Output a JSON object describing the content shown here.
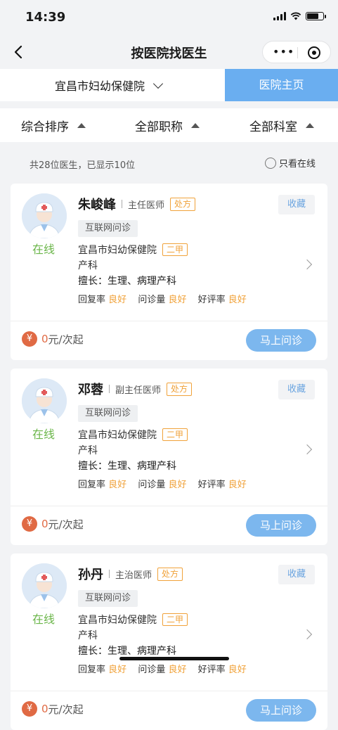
{
  "status": {
    "time": "14:39"
  },
  "nav": {
    "title": "按医院找医生"
  },
  "hospital_bar": {
    "name": "宜昌市妇幼保健院",
    "home_button": "医院主页"
  },
  "filters": [
    {
      "label": "综合排序"
    },
    {
      "label": "全部职称"
    },
    {
      "label": "全部科室"
    }
  ],
  "summary": {
    "count_text": "共28位医生，已显示10位",
    "online_only": "只看在线"
  },
  "doctors": [
    {
      "name": "朱峻峰",
      "title": "主任医师",
      "rx_tag": "处方",
      "favorite": "收藏",
      "status": "在线",
      "service": "互联网问诊",
      "hospital": "宜昌市妇幼保健院",
      "level": "二甲",
      "dept": "产科",
      "skill": "擅长：生理、病理产科",
      "reply_label": "回复率",
      "reply_value": "良好",
      "volume_label": "问诊量",
      "volume_value": "良好",
      "rating_label": "好评率",
      "rating_value": "良好",
      "price_symbol": "¥",
      "price_num": "0",
      "price_unit": "元/次起",
      "consult": "马上问诊"
    },
    {
      "name": "邓蓉",
      "title": "副主任医师",
      "rx_tag": "处方",
      "favorite": "收藏",
      "status": "在线",
      "service": "互联网问诊",
      "hospital": "宜昌市妇幼保健院",
      "level": "二甲",
      "dept": "产科",
      "skill": "擅长：生理、病理产科",
      "reply_label": "回复率",
      "reply_value": "良好",
      "volume_label": "问诊量",
      "volume_value": "良好",
      "rating_label": "好评率",
      "rating_value": "良好",
      "price_symbol": "¥",
      "price_num": "0",
      "price_unit": "元/次起",
      "consult": "马上问诊"
    },
    {
      "name": "孙丹",
      "title": "主治医师",
      "rx_tag": "处方",
      "favorite": "收藏",
      "status": "在线",
      "service": "互联网问诊",
      "hospital": "宜昌市妇幼保健院",
      "level": "二甲",
      "dept": "产科",
      "skill": "擅长：生理、病理产科",
      "reply_label": "回复率",
      "reply_value": "良好",
      "volume_label": "问诊量",
      "volume_value": "良好",
      "rating_label": "好评率",
      "rating_value": "良好",
      "price_symbol": "¥",
      "price_num": "0",
      "price_unit": "元/次起",
      "consult": "马上问诊"
    }
  ]
}
